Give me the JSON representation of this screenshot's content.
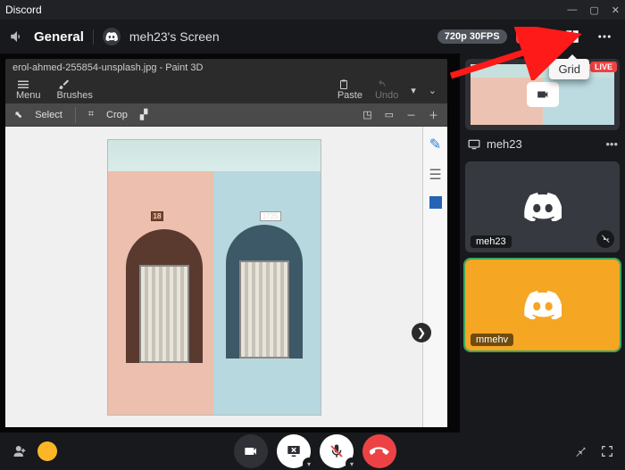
{
  "app": {
    "name": "Discord"
  },
  "header": {
    "channel": "General",
    "screen_owner": "meh23's Screen",
    "quality_badge": "720p 30FPS",
    "live_badge": "LIVE",
    "grid_tooltip": "Grid"
  },
  "shared_app": {
    "window_title": "erol-ahmed-255854-unsplash.jpg - Paint 3D",
    "menu_label": "Menu",
    "brushes_label": "Brushes",
    "paste_label": "Paste",
    "undo_label": "Undo",
    "select_label": "Select",
    "crop_label": "Crop",
    "house_number_left": "18",
    "house_number_right": "1725"
  },
  "sidebar": {
    "thumb_live": "LIVE",
    "screenshare_user": "meh23",
    "participants": [
      {
        "name": "meh23",
        "muted": true
      },
      {
        "name": "mmehv",
        "muted": false
      }
    ]
  },
  "footer": {
    "icons": {
      "camera": "camera-icon",
      "screenshare": "screenshare-icon",
      "mic": "mic-muted-icon",
      "hangup": "hangup-icon",
      "pin": "pin-icon",
      "expand": "expand-icon"
    }
  }
}
